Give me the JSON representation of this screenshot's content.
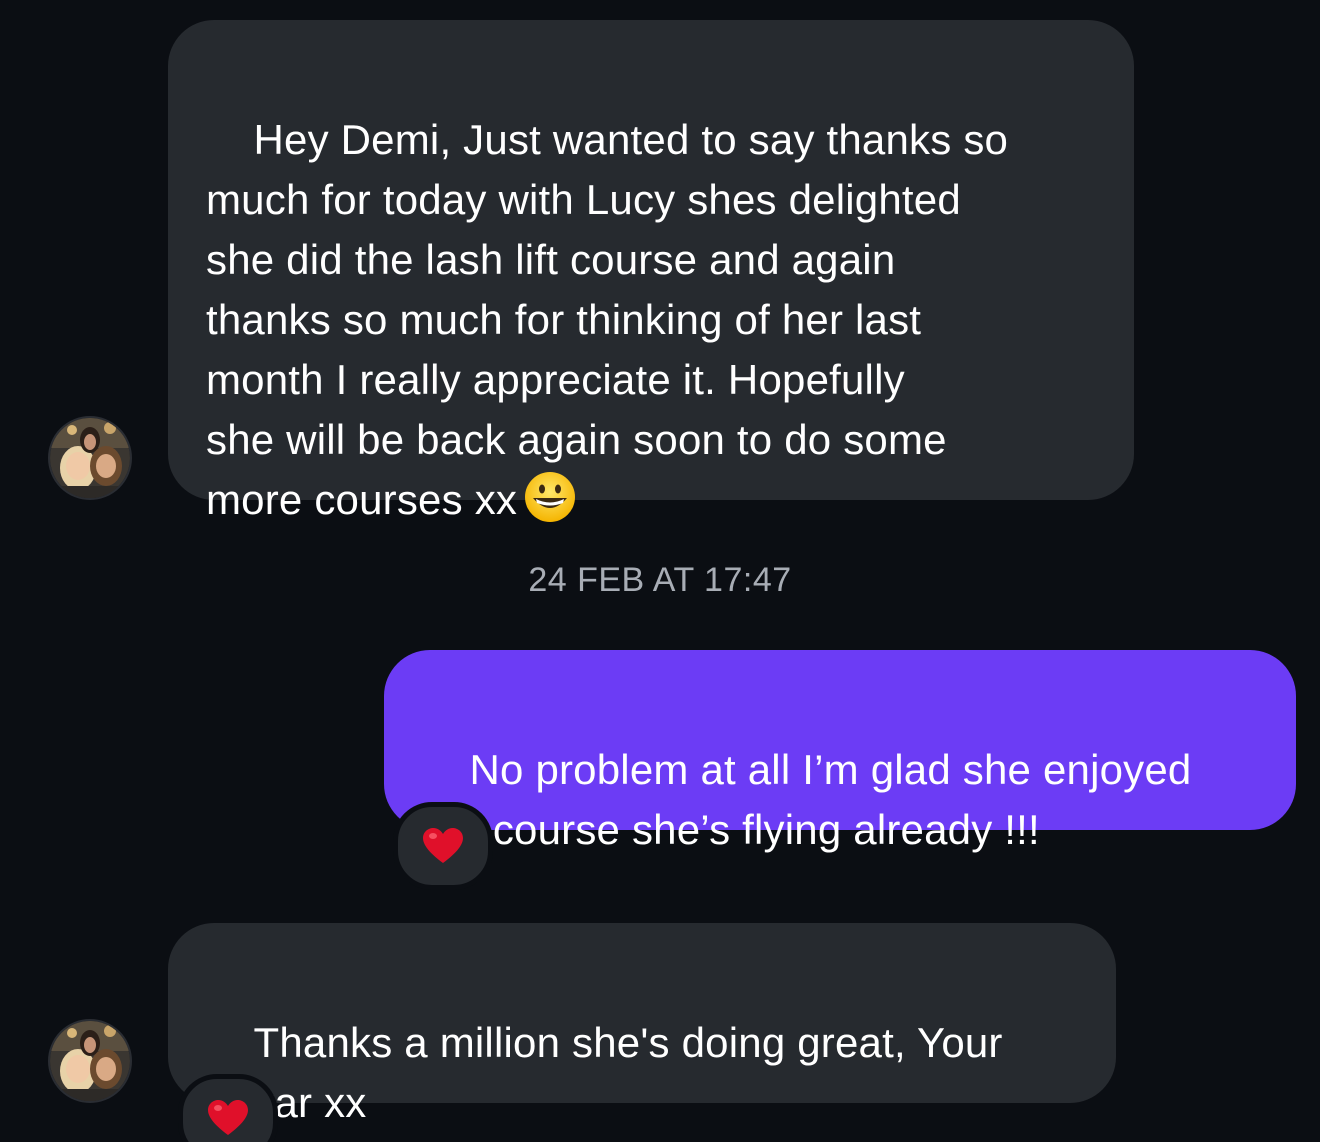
{
  "conversation": {
    "messages": [
      {
        "direction": "incoming",
        "text": "Hey Demi, Just wanted to say thanks so\nmuch for today with Lucy shes delighted\nshe did the lash lift course and again\nthanks so much for thinking of her last\nmonth I really appreciate it. Hopefully\nshe will be back again soon to do some\nmore courses xx",
        "trailing_emoji": "grinning-face-emoji"
      },
      {
        "direction": "outgoing",
        "text": "No problem at all I’m glad she enjoyed\nthe course she’s flying already !!!",
        "reaction": "red-heart-emoji"
      },
      {
        "direction": "incoming",
        "text": "Thanks a million she's doing great, Your\na star xx",
        "reaction": "red-heart-emoji"
      }
    ],
    "timestamp": "24 FEB AT 17:47"
  },
  "colors": {
    "background": "#0b0e13",
    "incoming_bubble": "#262a2f",
    "outgoing_bubble": "#6c3cf5",
    "timestamp_text": "#a8adb5",
    "heart": "#e0102a"
  }
}
